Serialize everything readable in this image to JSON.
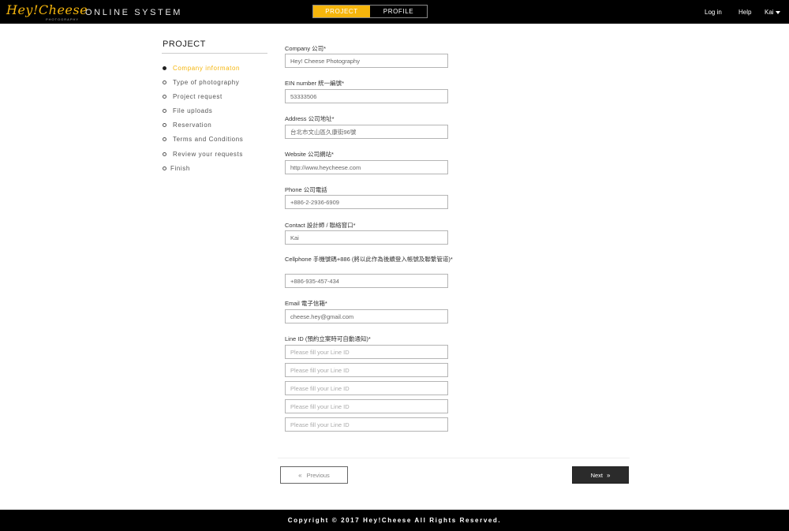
{
  "header": {
    "logo_text": "Hey!Cheese",
    "logo_sub": "PHOTOGRAPHY",
    "system_name": "ONLINE SYSTEM",
    "tabs": [
      {
        "label": "PROJECT"
      },
      {
        "label": "PROFILE"
      }
    ],
    "login": "Log in",
    "help": "Help",
    "user": "Kai"
  },
  "sidebar": {
    "title": "PROJECT",
    "steps": [
      {
        "label": "Company informaton"
      },
      {
        "label": "Type of photography"
      },
      {
        "label": "Project request"
      },
      {
        "label": "File uploads"
      },
      {
        "label": "Reservation"
      },
      {
        "label": "Terms and Conditions"
      },
      {
        "label": "Review your requests"
      },
      {
        "label": "Finish"
      }
    ],
    "active_step": 0
  },
  "form": {
    "company": {
      "label": "Company 公司*",
      "value": "Hey! Cheese Photography"
    },
    "ein": {
      "label": "EIN number 統一編號*",
      "value": "53333506"
    },
    "address": {
      "label": "Address 公司地址*",
      "value": "台北市文山區久康街96號"
    },
    "website": {
      "label": "Website 公司網站*",
      "value": "http://www.heycheese.com"
    },
    "phone": {
      "label": "Phone 公司電話",
      "value": "+886-2-2936-6909"
    },
    "contact": {
      "label": "Contact 設計師 / 聯絡窗口*",
      "value": "Kai"
    },
    "cellphone": {
      "label": "Cellphone 手機號碼+886 (將以此作為後續登入帳號及聯繫管道)*",
      "value": "+886-935-457-434"
    },
    "email": {
      "label": "Email 電子信箱*",
      "value": "cheese.hey@gmail.com"
    },
    "line": {
      "label": "Line ID (預約立案時可自動通知)*",
      "placeholder": "Please fill your Line ID"
    }
  },
  "actions": {
    "previous": "Previous",
    "next": "Next"
  },
  "footer": {
    "copyright": "Copyright © 2017 Hey!Cheese All Rights Reserved."
  },
  "colors": {
    "accent": "#f5b50c",
    "topbar": "#000000",
    "next_button": "#2b2b2b"
  }
}
